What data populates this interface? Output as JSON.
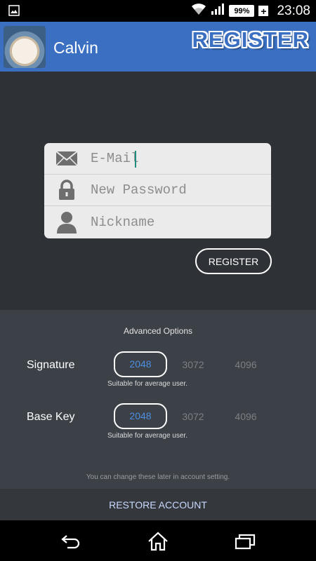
{
  "status_bar": {
    "time": "23:08",
    "battery_percent": "99%",
    "charging_symbol": "+",
    "icons": [
      "image-notification-icon",
      "wifi-icon",
      "signal-icon",
      "battery-icon"
    ]
  },
  "app_bar": {
    "app_title": "Calvin",
    "screen_title": "REGISTER"
  },
  "form": {
    "email": {
      "value": "",
      "placeholder": "E-Mail",
      "icon": "mail-icon"
    },
    "password": {
      "value": "",
      "placeholder": "New Password",
      "icon": "lock-icon"
    },
    "nickname": {
      "value": "",
      "placeholder": "Nickname",
      "icon": "person-icon"
    }
  },
  "register_label": "REGISTER",
  "advanced": {
    "title": "Advanced Options",
    "signature": {
      "label": "Signature",
      "options": [
        "2048",
        "3072",
        "4096"
      ],
      "selected": "2048",
      "note": "Suitable for average user."
    },
    "base_key": {
      "label": "Base Key",
      "options": [
        "2048",
        "3072",
        "4096"
      ],
      "selected": "2048",
      "note": "Suitable for average user."
    },
    "footer_note": "You can change these later in account setting."
  },
  "restore_label": "RESTORE ACCOUNT",
  "nav": [
    "back-icon",
    "home-icon",
    "recents-icon"
  ],
  "colors": {
    "accent": "#3a6fc1",
    "selected_option": "#4d8fe0",
    "background": "#2e3136"
  }
}
